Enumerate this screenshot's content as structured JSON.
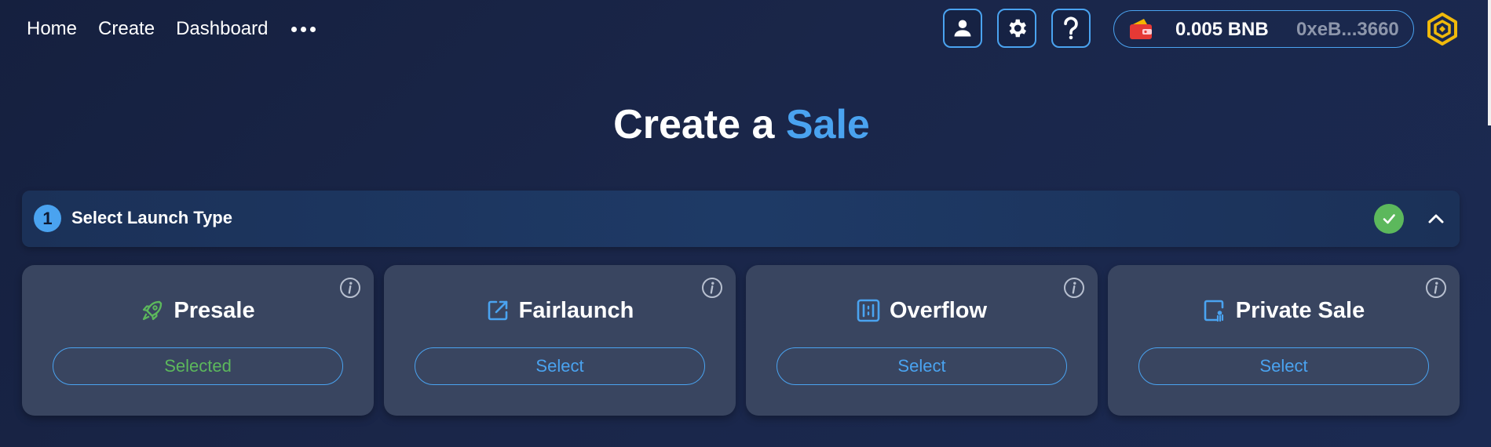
{
  "nav": {
    "links": [
      "Home",
      "Create",
      "Dashboard"
    ],
    "more_icon": "more-dots-icon"
  },
  "header_actions": {
    "profile_icon": "user-icon",
    "settings_icon": "gear-icon",
    "help_icon": "question-icon"
  },
  "wallet": {
    "icon": "wallet-icon",
    "balance": "0.005 BNB",
    "address": "0xeB...3660",
    "chain_logo": "bnb-chain-logo"
  },
  "title": {
    "prefix": "Create a",
    "highlight": "Sale"
  },
  "step": {
    "number": "1",
    "label": "Select Launch Type",
    "status_icon": "check-icon",
    "toggle_icon": "chevron-up-icon"
  },
  "cards": [
    {
      "title": "Presale",
      "icon": "rocket-icon",
      "button": "Selected",
      "selected": true
    },
    {
      "title": "Fairlaunch",
      "icon": "external-link-icon",
      "button": "Select",
      "selected": false
    },
    {
      "title": "Overflow",
      "icon": "overflow-icon",
      "button": "Select",
      "selected": false
    },
    {
      "title": "Private Sale",
      "icon": "private-sale-icon",
      "button": "Select",
      "selected": false
    }
  ],
  "colors": {
    "accent": "#4aa3f0",
    "success": "#5cb85c",
    "background": "#1a2649",
    "card": "#394560"
  }
}
